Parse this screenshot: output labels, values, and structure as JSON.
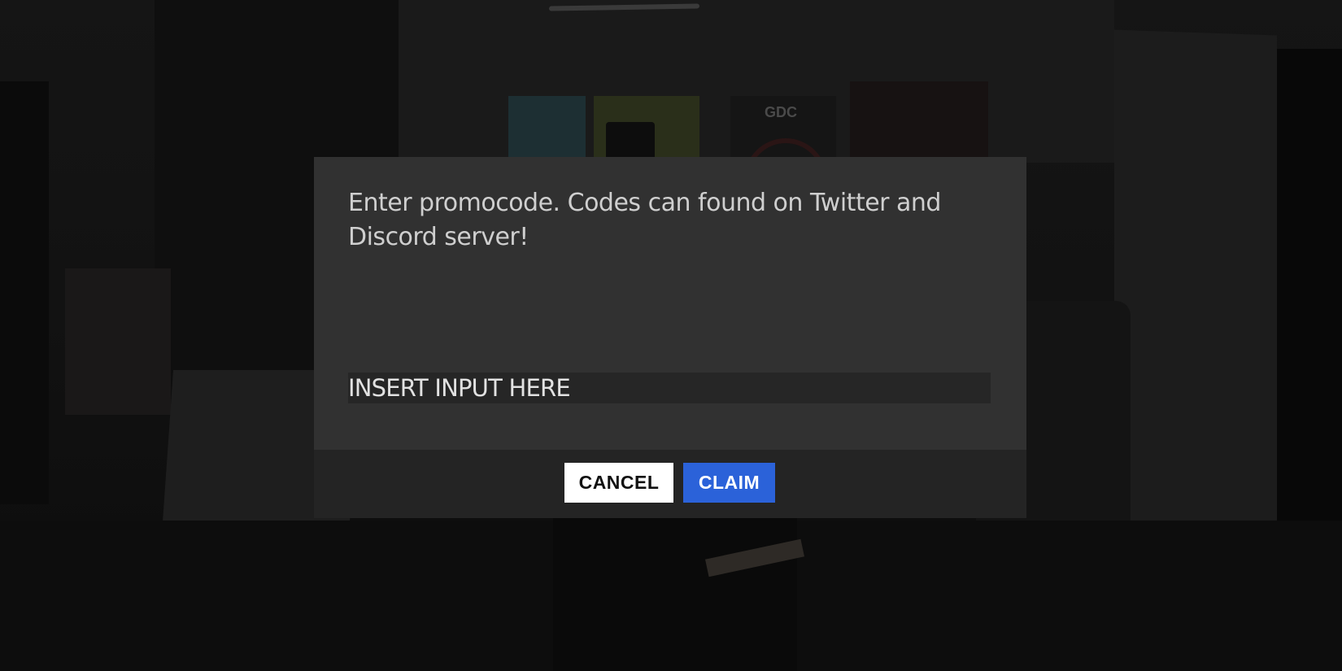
{
  "dialog": {
    "message": "Enter promocode. Codes can found on Twitter and Discord server!",
    "input": {
      "value": "",
      "placeholder": "INSERT INPUT HERE"
    },
    "cancel_label": "CANCEL",
    "claim_label": "CLAIM"
  },
  "background": {
    "poster_label": "GDC"
  },
  "colors": {
    "dialog_bg": "#313131",
    "footer_bg": "#242424",
    "input_bg": "#262626",
    "cancel_bg": "#ffffff",
    "claim_bg": "#2b62d9"
  }
}
